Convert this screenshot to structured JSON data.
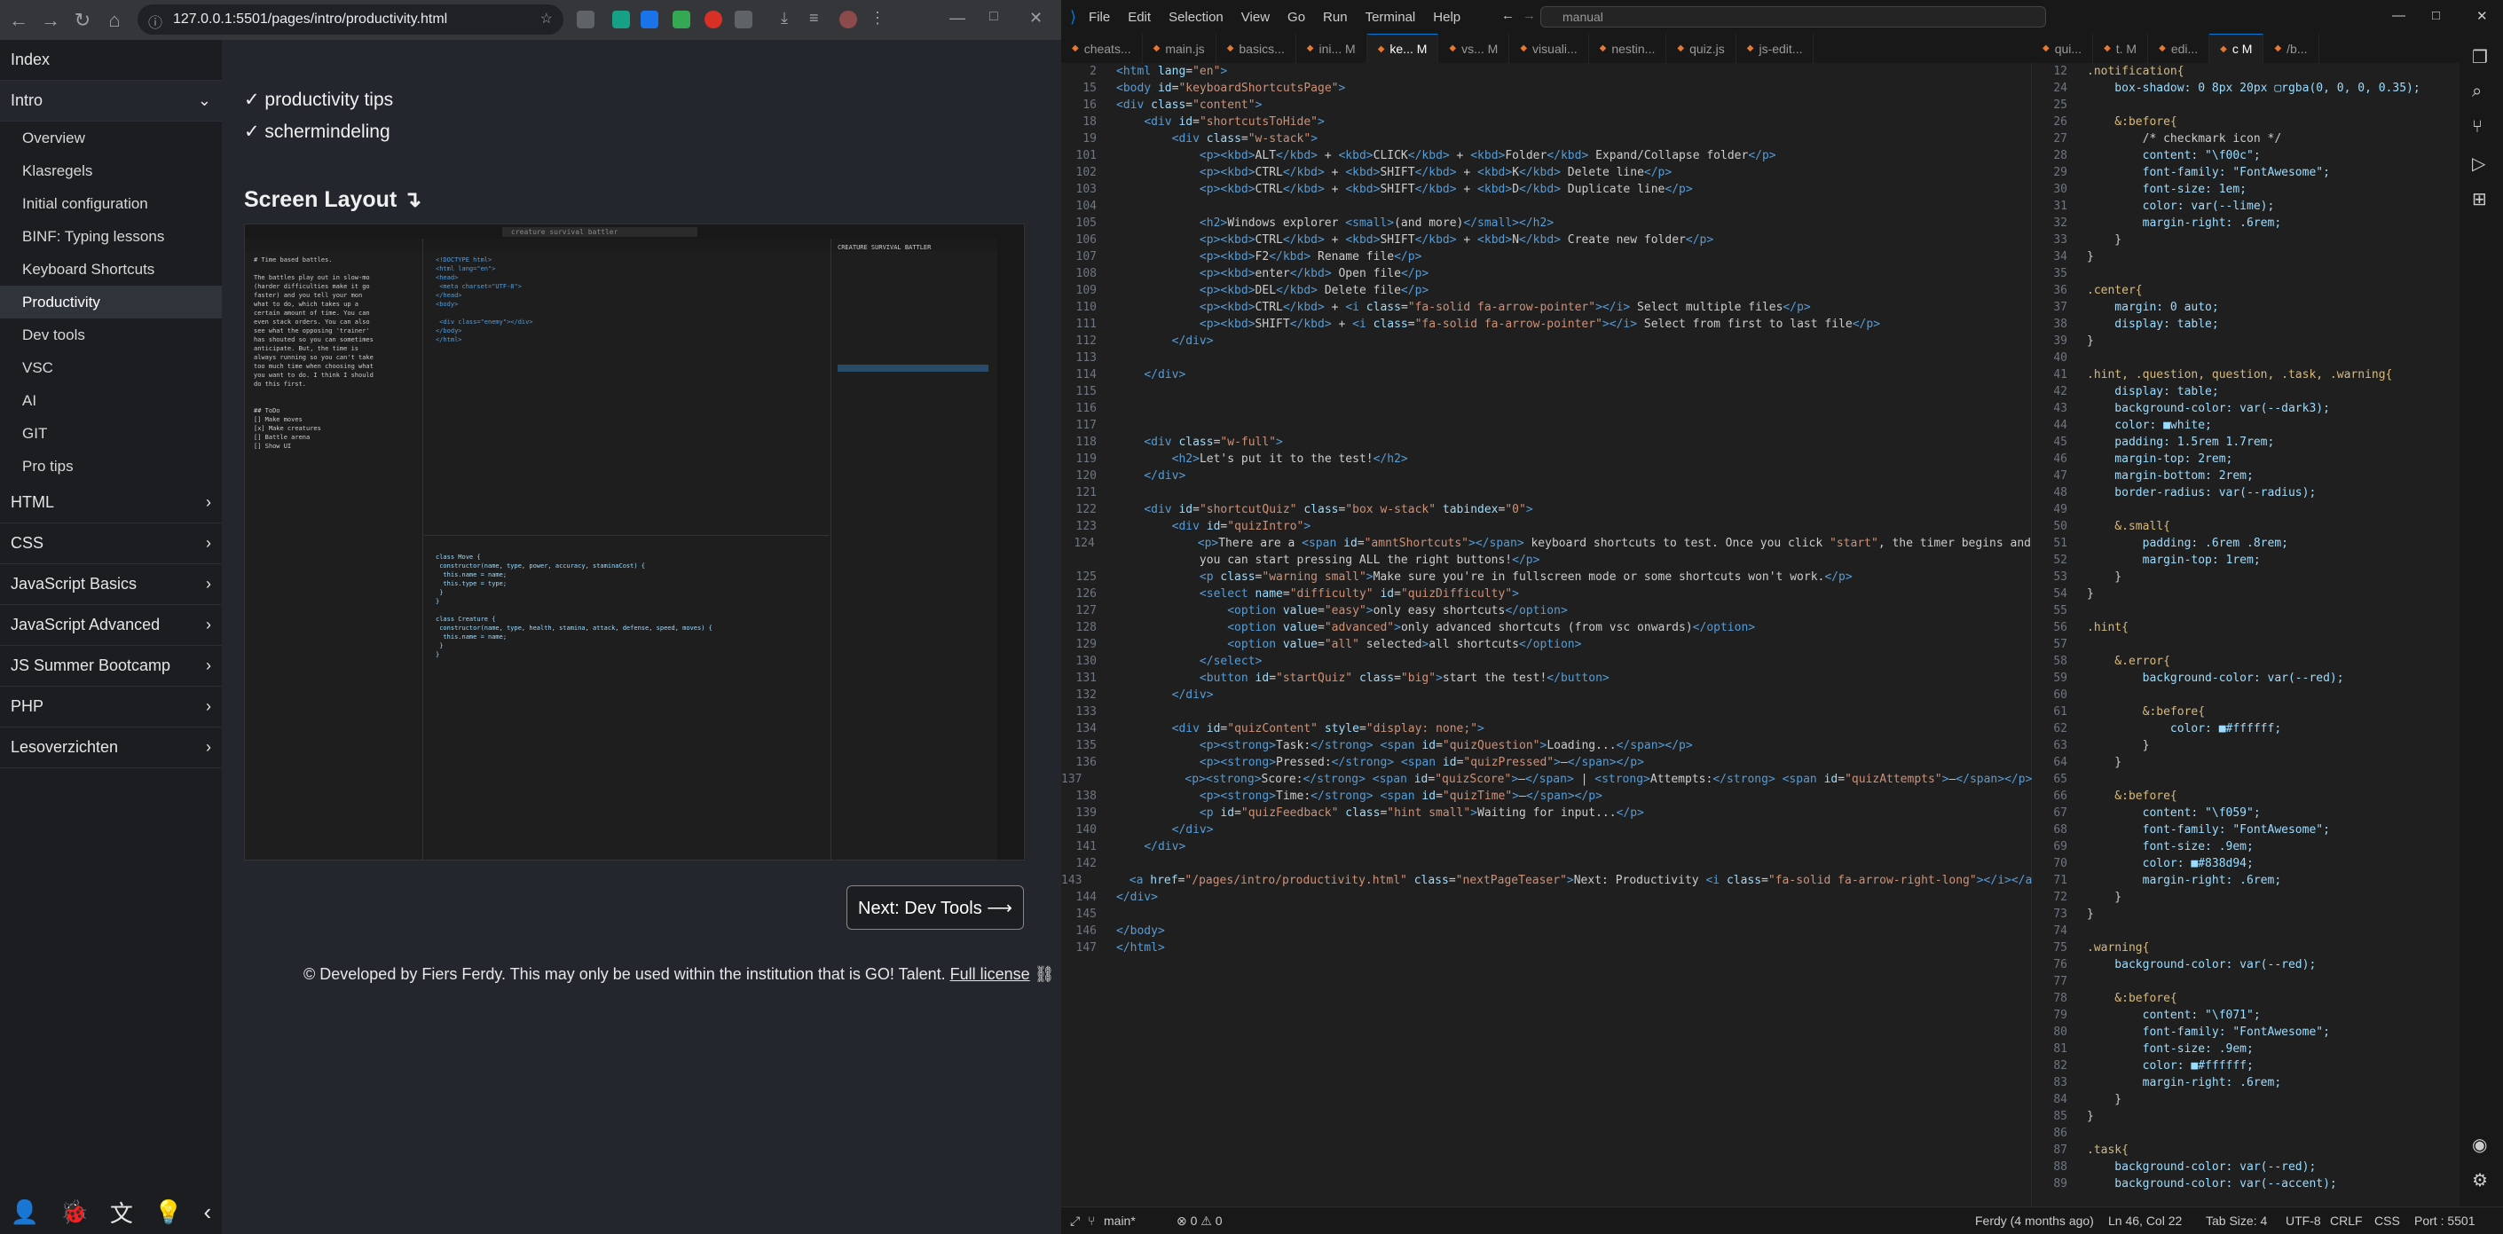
{
  "browser": {
    "url": "127.0.0.1:5501/pages/intro/productivity.html"
  },
  "sidebar": {
    "top": "Index",
    "intro": "Intro",
    "sub_items": [
      "Overview",
      "Klasregels",
      "Initial configuration",
      "BINF: Typing lessons",
      "Keyboard Shortcuts",
      "Productivity",
      "Dev tools",
      "VSC",
      "AI",
      "GIT",
      "Pro tips"
    ],
    "sections": [
      "HTML",
      "CSS",
      "JavaScript Basics",
      "JavaScript Advanced",
      "JS Summer Bootcamp",
      "PHP",
      "Lesoverzichten"
    ]
  },
  "page": {
    "check1": "✓ productivity tips",
    "check2": "✓ schermindeling",
    "heading": "Screen Layout ↴",
    "next_label": "Next: Dev Tools  ⟶",
    "footer_text": "© Developed by Fiers Ferdy. This may only be used within the institution that is GO! Talent.",
    "footer_link": "Full license",
    "shot_code": [
      "# Time based battles.",
      "",
      "The battles play out in slow-mo",
      "(harder difficulties make it go",
      "faster) and you tell your mon",
      "what to do, which takes up a",
      "certain amount of time. You can",
      "even stack orders. You can also",
      "see what the opposing 'trainer'",
      "has shouted so you can sometimes",
      "anticipate. But, the time is",
      "always running so you can't take",
      "too much time when choosing what",
      "you want to do. I think I should",
      "do this first.",
      "",
      "",
      "## ToDo",
      "[] Make moves",
      "[x] Make creatures",
      "[] Battle arena",
      "[] Show UI"
    ],
    "shot_search": "creature survival battler",
    "shot_explorer": "CREATURE SURVIVAL BATTLER"
  },
  "vscode": {
    "menu": [
      "File",
      "Edit",
      "Selection",
      "View",
      "Go",
      "Run",
      "Terminal",
      "Help"
    ],
    "search": "manual",
    "tabs_left": [
      {
        "label": "cheats...",
        "active": false
      },
      {
        "label": "main.js",
        "active": false
      },
      {
        "label": "basics...",
        "active": false
      },
      {
        "label": "ini...  M",
        "active": false
      },
      {
        "label": "ke...  M",
        "active": true
      },
      {
        "label": "vs...  M",
        "active": false
      },
      {
        "label": "visuali...",
        "active": false
      },
      {
        "label": "nestin...",
        "active": false
      },
      {
        "label": "quiz.js",
        "active": false
      },
      {
        "label": "js-edit...",
        "active": false
      }
    ],
    "tabs_right": [
      {
        "label": "qui...",
        "active": false
      },
      {
        "label": "t. M",
        "active": false
      },
      {
        "label": "edi...",
        "active": false
      },
      {
        "label": "c M",
        "active": true
      },
      {
        "label": "/b...",
        "active": false
      }
    ],
    "html_lines": [
      {
        "n": "2",
        "t": "<html lang=\"en\">"
      },
      {
        "n": "15",
        "t": "<body id=\"keyboardShortcutsPage\">"
      },
      {
        "n": "16",
        "t": "<div class=\"content\">"
      },
      {
        "n": "18",
        "t": "    <div id=\"shortcutsToHide\">"
      },
      {
        "n": "19",
        "t": "        <div class=\"w-stack\">"
      },
      {
        "n": "101",
        "t": "            <p><kbd>ALT</kbd> + <kbd>CLICK</kbd> + <kbd>Folder</kbd> Expand/Collapse folder</p>"
      },
      {
        "n": "102",
        "t": "            <p><kbd>CTRL</kbd> + <kbd>SHIFT</kbd> + <kbd>K</kbd> Delete line</p>"
      },
      {
        "n": "103",
        "t": "            <p><kbd>CTRL</kbd> + <kbd>SHIFT</kbd> + <kbd>D</kbd> Duplicate line</p>"
      },
      {
        "n": "104",
        "t": ""
      },
      {
        "n": "105",
        "t": "            <h2>Windows explorer <small>(and more)</small></h2>"
      },
      {
        "n": "106",
        "t": "            <p><kbd>CTRL</kbd> + <kbd>SHIFT</kbd> + <kbd>N</kbd> Create new folder</p>"
      },
      {
        "n": "107",
        "t": "            <p><kbd>F2</kbd> Rename file</p>"
      },
      {
        "n": "108",
        "t": "            <p><kbd>enter</kbd> Open file</p>"
      },
      {
        "n": "109",
        "t": "            <p><kbd>DEL</kbd> Delete file</p>"
      },
      {
        "n": "110",
        "t": "            <p><kbd>CTRL</kbd> + <i class=\"fa-solid fa-arrow-pointer\"></i> Select multiple files</p>"
      },
      {
        "n": "111",
        "t": "            <p><kbd>SHIFT</kbd> + <i class=\"fa-solid fa-arrow-pointer\"></i> Select from first to last file</p>"
      },
      {
        "n": "112",
        "t": "        </div>"
      },
      {
        "n": "113",
        "t": ""
      },
      {
        "n": "114",
        "t": "    </div>"
      },
      {
        "n": "115",
        "t": ""
      },
      {
        "n": "116",
        "t": ""
      },
      {
        "n": "117",
        "t": ""
      },
      {
        "n": "118",
        "t": "    <div class=\"w-full\">"
      },
      {
        "n": "119",
        "t": "        <h2>Let's put it to the test!</h2>"
      },
      {
        "n": "120",
        "t": "    </div>"
      },
      {
        "n": "121",
        "t": ""
      },
      {
        "n": "122",
        "t": "    <div id=\"shortcutQuiz\" class=\"box w-stack\" tabindex=\"0\">"
      },
      {
        "n": "123",
        "t": "        <div id=\"quizIntro\">"
      },
      {
        "n": "124",
        "t": "            <p>There are a <span id=\"amntShortcuts\"></span> keyboard shortcuts to test. Once you click \"start\", the timer begins and"
      },
      {
        "n": "",
        "t": "            you can start pressing ALL the right buttons!</p>"
      },
      {
        "n": "125",
        "t": "            <p class=\"warning small\">Make sure you're in fullscreen mode or some shortcuts won't work.</p>"
      },
      {
        "n": "126",
        "t": "            <select name=\"difficulty\" id=\"quizDifficulty\">"
      },
      {
        "n": "127",
        "t": "                <option value=\"easy\">only easy shortcuts</option>"
      },
      {
        "n": "128",
        "t": "                <option value=\"advanced\">only advanced shortcuts (from vsc onwards)</option>"
      },
      {
        "n": "129",
        "t": "                <option value=\"all\" selected>all shortcuts</option>"
      },
      {
        "n": "130",
        "t": "            </select>"
      },
      {
        "n": "131",
        "t": "            <button id=\"startQuiz\" class=\"big\">start the test!</button>"
      },
      {
        "n": "132",
        "t": "        </div>"
      },
      {
        "n": "133",
        "t": ""
      },
      {
        "n": "134",
        "t": "        <div id=\"quizContent\" style=\"display: none;\">"
      },
      {
        "n": "135",
        "t": "            <p><strong>Task:</strong> <span id=\"quizQuestion\">Loading...</span></p>"
      },
      {
        "n": "136",
        "t": "            <p><strong>Pressed:</strong> <span id=\"quizPressed\">—</span></p>"
      },
      {
        "n": "137",
        "t": "            <p><strong>Score:</strong> <span id=\"quizScore\">—</span> | <strong>Attempts:</strong> <span id=\"quizAttempts\">—</span></p>"
      },
      {
        "n": "138",
        "t": "            <p><strong>Time:</strong> <span id=\"quizTime\">—</span></p>"
      },
      {
        "n": "139",
        "t": "            <p id=\"quizFeedback\" class=\"hint small\">Waiting for input...</p>"
      },
      {
        "n": "140",
        "t": "        </div>"
      },
      {
        "n": "141",
        "t": "    </div>"
      },
      {
        "n": "142",
        "t": ""
      },
      {
        "n": "143",
        "t": "    <a href=\"/pages/intro/productivity.html\" class=\"nextPageTeaser\">Next: Productivity <i class=\"fa-solid fa-arrow-right-long\"></i></a>"
      },
      {
        "n": "144",
        "t": "</div>"
      },
      {
        "n": "145",
        "t": ""
      },
      {
        "n": "146",
        "t": "</body>"
      },
      {
        "n": "147",
        "t": "</html>"
      }
    ],
    "css_lines": [
      {
        "n": "12",
        "t": ".notification{"
      },
      {
        "n": "24",
        "t": "    box-shadow: 0 8px 20px ▢rgba(0, 0, 0, 0.35);"
      },
      {
        "n": "25",
        "t": ""
      },
      {
        "n": "26",
        "t": "    &:before{"
      },
      {
        "n": "27",
        "t": "        /* checkmark icon */"
      },
      {
        "n": "28",
        "t": "        content: \"\\f00c\";"
      },
      {
        "n": "29",
        "t": "        font-family: \"FontAwesome\";"
      },
      {
        "n": "30",
        "t": "        font-size: 1em;"
      },
      {
        "n": "31",
        "t": "        color: var(--lime);"
      },
      {
        "n": "32",
        "t": "        margin-right: .6rem;"
      },
      {
        "n": "33",
        "t": "    }"
      },
      {
        "n": "34",
        "t": "}"
      },
      {
        "n": "35",
        "t": ""
      },
      {
        "n": "36",
        "t": ".center{"
      },
      {
        "n": "37",
        "t": "    margin: 0 auto;"
      },
      {
        "n": "38",
        "t": "    display: table;"
      },
      {
        "n": "39",
        "t": "}"
      },
      {
        "n": "40",
        "t": ""
      },
      {
        "n": "41",
        "t": ".hint, .question, question, .task, .warning{"
      },
      {
        "n": "42",
        "t": "    display: table;"
      },
      {
        "n": "43",
        "t": "    background-color: var(--dark3);"
      },
      {
        "n": "44",
        "t": "    color: ■white;"
      },
      {
        "n": "45",
        "t": "    padding: 1.5rem 1.7rem;"
      },
      {
        "n": "46",
        "t": "    margin-top: 2rem;"
      },
      {
        "n": "47",
        "t": "    margin-bottom: 2rem;"
      },
      {
        "n": "48",
        "t": "    border-radius: var(--radius);"
      },
      {
        "n": "49",
        "t": ""
      },
      {
        "n": "50",
        "t": "    &.small{"
      },
      {
        "n": "51",
        "t": "        padding: .6rem .8rem;"
      },
      {
        "n": "52",
        "t": "        margin-top: 1rem;"
      },
      {
        "n": "53",
        "t": "    }"
      },
      {
        "n": "54",
        "t": "}"
      },
      {
        "n": "55",
        "t": ""
      },
      {
        "n": "56",
        "t": ".hint{"
      },
      {
        "n": "57",
        "t": ""
      },
      {
        "n": "58",
        "t": "    &.error{"
      },
      {
        "n": "59",
        "t": "        background-color: var(--red);"
      },
      {
        "n": "60",
        "t": ""
      },
      {
        "n": "61",
        "t": "        &:before{"
      },
      {
        "n": "62",
        "t": "            color: ■#ffffff;"
      },
      {
        "n": "63",
        "t": "        }"
      },
      {
        "n": "64",
        "t": "    }"
      },
      {
        "n": "65",
        "t": ""
      },
      {
        "n": "66",
        "t": "    &:before{"
      },
      {
        "n": "67",
        "t": "        content: \"\\f059\";"
      },
      {
        "n": "68",
        "t": "        font-family: \"FontAwesome\";"
      },
      {
        "n": "69",
        "t": "        font-size: .9em;"
      },
      {
        "n": "70",
        "t": "        color: ■#838d94;"
      },
      {
        "n": "71",
        "t": "        margin-right: .6rem;"
      },
      {
        "n": "72",
        "t": "    }"
      },
      {
        "n": "73",
        "t": "}"
      },
      {
        "n": "74",
        "t": ""
      },
      {
        "n": "75",
        "t": ".warning{"
      },
      {
        "n": "76",
        "t": "    background-color: var(--red);"
      },
      {
        "n": "77",
        "t": ""
      },
      {
        "n": "78",
        "t": "    &:before{"
      },
      {
        "n": "79",
        "t": "        content: \"\\f071\";"
      },
      {
        "n": "80",
        "t": "        font-family: \"FontAwesome\";"
      },
      {
        "n": "81",
        "t": "        font-size: .9em;"
      },
      {
        "n": "82",
        "t": "        color: ■#ffffff;"
      },
      {
        "n": "83",
        "t": "        margin-right: .6rem;"
      },
      {
        "n": "84",
        "t": "    }"
      },
      {
        "n": "85",
        "t": "}"
      },
      {
        "n": "86",
        "t": ""
      },
      {
        "n": "87",
        "t": ".task{"
      },
      {
        "n": "88",
        "t": "    background-color: var(--red);"
      },
      {
        "n": "89",
        "t": "    background-color: var(--accent);"
      }
    ],
    "status": {
      "branch": "main*",
      "problems": "⊗ 0 ⚠ 0",
      "blame": "Ferdy (4 months ago)",
      "position": "Ln 46, Col 22",
      "tab": "Tab Size: 4",
      "encoding": "UTF-8",
      "eol": "CRLF",
      "lang": "CSS",
      "port": "Port : 5501"
    },
    "colors": {
      "accent": "#0078d4",
      "tag": "#569cd6",
      "attr": "#9cdcfe",
      "string": "#ce9178"
    }
  }
}
